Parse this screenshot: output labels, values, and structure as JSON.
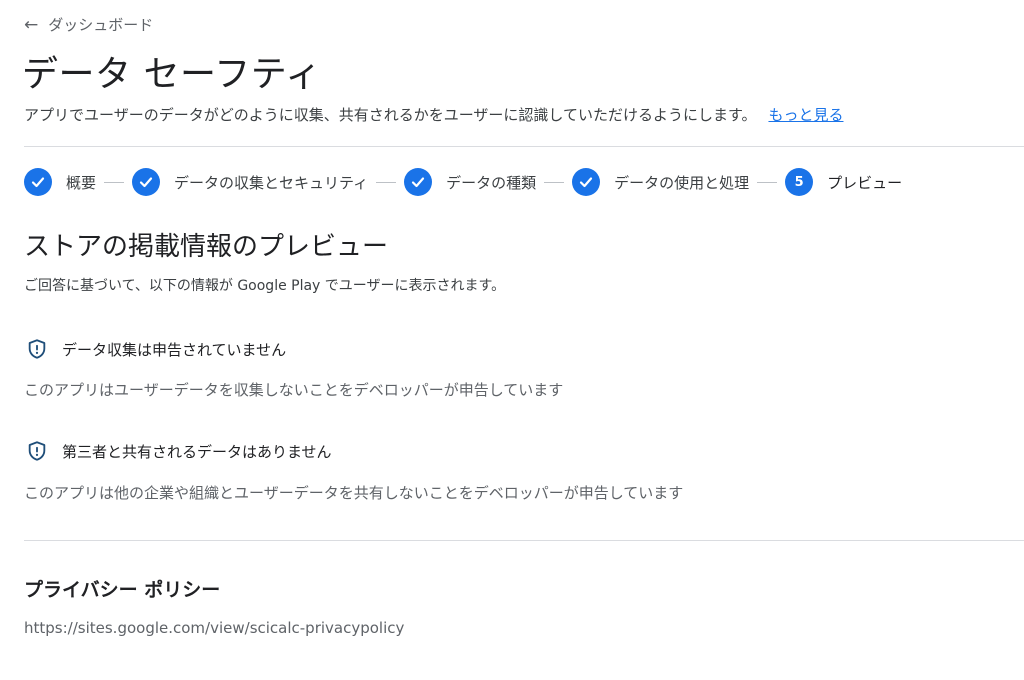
{
  "header": {
    "back_label": "ダッシュボード",
    "title": "データ セーフティ",
    "subtitle": "アプリでユーザーのデータがどのように収集、共有されるかをユーザーに認識していただけるようにします。",
    "more_link": "もっと見る"
  },
  "stepper": {
    "steps": [
      {
        "label": "概要",
        "state": "done"
      },
      {
        "label": "データの収集とセキュリティ",
        "state": "done"
      },
      {
        "label": "データの種類",
        "state": "done"
      },
      {
        "label": "データの使用と処理",
        "state": "done"
      },
      {
        "label": "プレビュー",
        "state": "current",
        "number": "5"
      }
    ],
    "accent_color": "#1a73e8"
  },
  "preview": {
    "title": "ストアの掲載情報のプレビュー",
    "description": "ご回答に基づいて、以下の情報が Google Play でユーザーに表示されます。",
    "items": [
      {
        "icon": "shield-alert-icon",
        "title": "データ収集は申告されていません",
        "description": "このアプリはユーザーデータを収集しないことをデベロッパーが申告しています"
      },
      {
        "icon": "shield-alert-icon",
        "title": "第三者と共有されるデータはありません",
        "description": "このアプリは他の企業や組織とユーザーデータを共有しないことをデベロッパーが申告しています"
      }
    ]
  },
  "privacy_policy": {
    "title": "プライバシー ポリシー",
    "url": "https://sites.google.com/view/scicalc-privacypolicy"
  }
}
